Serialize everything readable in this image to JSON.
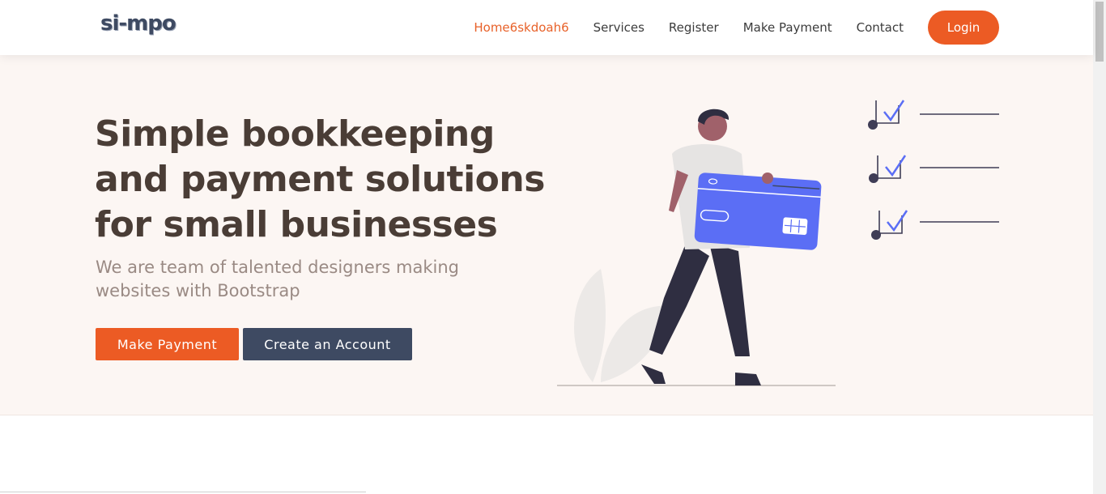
{
  "header": {
    "logo_text": "si-mpo",
    "nav": [
      {
        "label": "Home6skdoah6",
        "active": true
      },
      {
        "label": "Services",
        "active": false
      },
      {
        "label": "Register",
        "active": false
      },
      {
        "label": "Make Payment",
        "active": false
      },
      {
        "label": "Contact",
        "active": false
      }
    ],
    "login_label": "Login"
  },
  "hero": {
    "title": "Simple bookkeeping and payment solutions for small businesses",
    "subtitle": "We are team of talented designers making websites with Bootstrap",
    "primary_button": "Make Payment",
    "secondary_button": "Create an Account",
    "illustration_icon": "person-holding-credit-card-illustration"
  },
  "colors": {
    "accent": "#ec5b24",
    "dark": "#3e4a62",
    "hero_bg": "#fcf6f3",
    "card_blue": "#5b6ef5"
  }
}
